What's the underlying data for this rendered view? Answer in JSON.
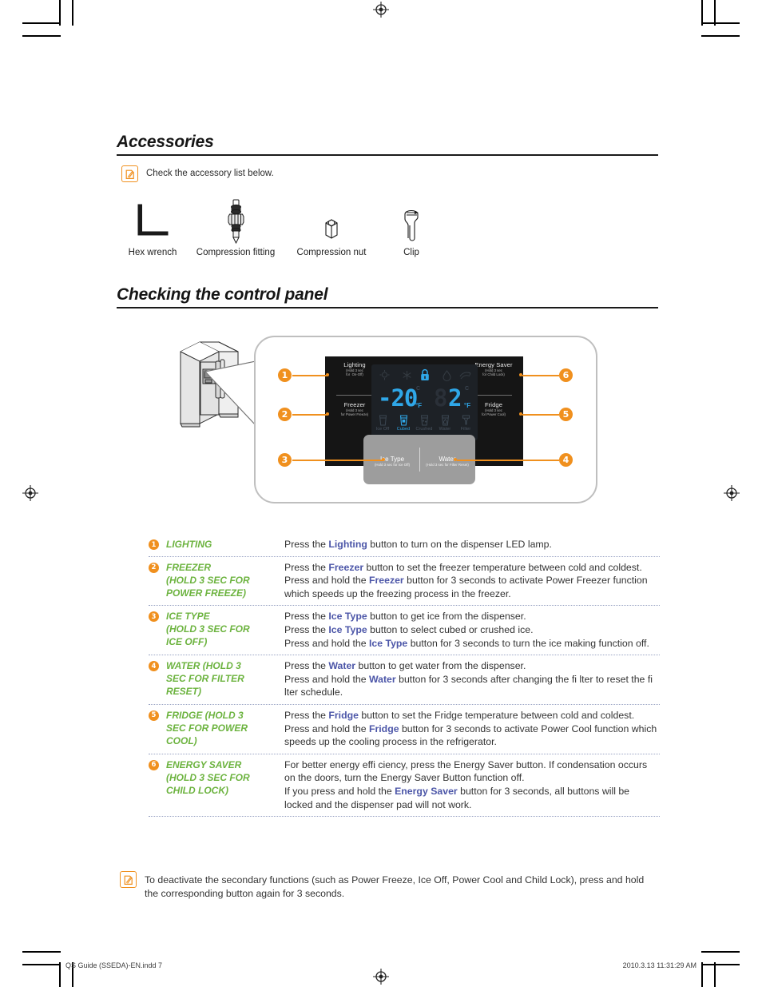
{
  "sections": {
    "accessories": {
      "title": "Accessories",
      "note": "Check the accessory list below.",
      "items": [
        {
          "icon": "hex-wrench-icon",
          "label": "Hex wrench"
        },
        {
          "icon": "compression-fitting-icon",
          "label": "Compression fitting"
        },
        {
          "icon": "compression-nut-icon",
          "label": "Compression nut"
        },
        {
          "icon": "clip-icon",
          "label": "Clip"
        }
      ]
    },
    "control_panel": {
      "title": "Checking the control panel",
      "display": {
        "freezer_temp": "-20",
        "freezer_unit": "°F",
        "freezer_unit_alt": "C",
        "fridge_temp": "2",
        "fridge_unit": "°F",
        "fridge_unit_alt": "C",
        "lock_icon": "child-lock-icon",
        "top_icons": [
          "lighting-indicator-icon",
          "power-freeze-indicator-icon",
          "child-lock-indicator-icon",
          "power-cool-indicator-icon",
          "energy-saver-indicator-icon"
        ],
        "bottom_items": [
          {
            "label": "Ice Off",
            "icon": "ice-off-icon",
            "active": false
          },
          {
            "label": "Cubed",
            "icon": "cubed-ice-icon",
            "active": true
          },
          {
            "label": "Crushed",
            "icon": "crushed-ice-icon",
            "active": false
          },
          {
            "label": "Water",
            "icon": "water-icon",
            "active": false
          },
          {
            "label": "Filter",
            "icon": "filter-icon",
            "active": false
          }
        ]
      },
      "buttons": {
        "lighting": {
          "name": "Lighting",
          "sub": "(Hold 3 sec\nfor  On-Off)"
        },
        "freezer": {
          "name": "Freezer",
          "sub": "(Hold 3 sec\nfor Power Freeze)"
        },
        "energy_saver": {
          "name": "Energy Saver",
          "sub": "(Hold 3 sec\nfor Child Lock)"
        },
        "fridge": {
          "name": "Fridge",
          "sub": "(Hold 3 sec\nfor Power Cool)"
        },
        "ice_type": {
          "name": "Ice Type",
          "sub": "(Hold 3 sec for Ice Off)"
        },
        "water": {
          "name": "Water",
          "sub": "(Hold 3 sec for Filter Reset)"
        }
      },
      "callout_numbers": [
        "1",
        "2",
        "3",
        "4",
        "5",
        "6"
      ]
    }
  },
  "table": {
    "rows": [
      {
        "num": "1",
        "label": "LIGHTING",
        "lines": [
          [
            {
              "t": "Press the ",
              "b": false
            },
            {
              "t": "Lighting",
              "b": true
            },
            {
              "t": " button to turn on the dispenser LED lamp.",
              "b": false
            }
          ]
        ]
      },
      {
        "num": "2",
        "label": "FREEZER\n(HOLD 3 SEC FOR\nPOWER FREEZE)",
        "lines": [
          [
            {
              "t": "Press the ",
              "b": false
            },
            {
              "t": "Freezer",
              "b": true
            },
            {
              "t": " button to set the freezer temperature between cold and coldest.",
              "b": false
            }
          ],
          [
            {
              "t": "Press and hold the ",
              "b": false
            },
            {
              "t": "Freezer",
              "b": true
            },
            {
              "t": " button for 3 seconds to activate Power Freezer function which speeds up the freezing process in the freezer.",
              "b": false
            }
          ]
        ]
      },
      {
        "num": "3",
        "label": "ICE TYPE\n(HOLD 3 SEC FOR\nICE OFF)",
        "lines": [
          [
            {
              "t": "Press the ",
              "b": false
            },
            {
              "t": "Ice Type",
              "b": true
            },
            {
              "t": " button to get ice from the dispenser.",
              "b": false
            }
          ],
          [
            {
              "t": "Press the ",
              "b": false
            },
            {
              "t": "Ice Type",
              "b": true
            },
            {
              "t": " button to select cubed or crushed ice.",
              "b": false
            }
          ],
          [
            {
              "t": "Press and hold the ",
              "b": false
            },
            {
              "t": "Ice Type",
              "b": true
            },
            {
              "t": " button for 3 seconds to turn the ice making function off.",
              "b": false
            }
          ]
        ]
      },
      {
        "num": "4",
        "label": "WATER (HOLD 3\nSEC FOR FILTER\nRESET)",
        "lines": [
          [
            {
              "t": "Press the ",
              "b": false
            },
            {
              "t": "Water",
              "b": true
            },
            {
              "t": " button to get water from the dispenser.",
              "b": false
            }
          ],
          [
            {
              "t": "Press and hold the ",
              "b": false
            },
            {
              "t": "Water",
              "b": true
            },
            {
              "t": " button for 3 seconds after changing the fi lter to reset the fi lter schedule.",
              "b": false
            }
          ]
        ]
      },
      {
        "num": "5",
        "label": "FRIDGE (HOLD 3\nSEC FOR POWER\nCOOL)",
        "lines": [
          [
            {
              "t": "Press the ",
              "b": false
            },
            {
              "t": "Fridge",
              "b": true
            },
            {
              "t": " button to set the Fridge temperature between cold and coldest.",
              "b": false
            }
          ],
          [
            {
              "t": "Press and hold the ",
              "b": false
            },
            {
              "t": "Fridge",
              "b": true
            },
            {
              "t": " button for 3 seconds to activate Power Cool function which speeds up the cooling process in the refrigerator.",
              "b": false
            }
          ]
        ]
      },
      {
        "num": "6",
        "label": "ENERGY SAVER\n(HOLD 3 SEC FOR\nCHILD LOCK)",
        "lines": [
          [
            {
              "t": "For better energy effi ciency, press the Energy Saver button. If condensation occurs on the doors, turn the Energy Saver Button function off.",
              "b": false
            }
          ],
          [
            {
              "t": "If you press and hold the ",
              "b": false
            },
            {
              "t": "Energy Saver",
              "b": true
            },
            {
              "t": " button for 3 seconds, all buttons will be locked and the dispenser pad will not work.",
              "b": false
            }
          ]
        ]
      }
    ]
  },
  "footnote": "To deactivate the secondary functions (such as Power Freeze, Ice Off, Power Cool and Child Lock), press and hold the corresponding button again for 3 seconds.",
  "page_footer": {
    "left": "QS Guide (SSEDA)-EN.indd   7",
    "right": "2010.3.13   11:31:29 AM"
  },
  "colors": {
    "orange": "#F0901E",
    "green": "#6CB33F",
    "blue": "#4C56A8",
    "lcd_blue": "#2FA7E8"
  }
}
